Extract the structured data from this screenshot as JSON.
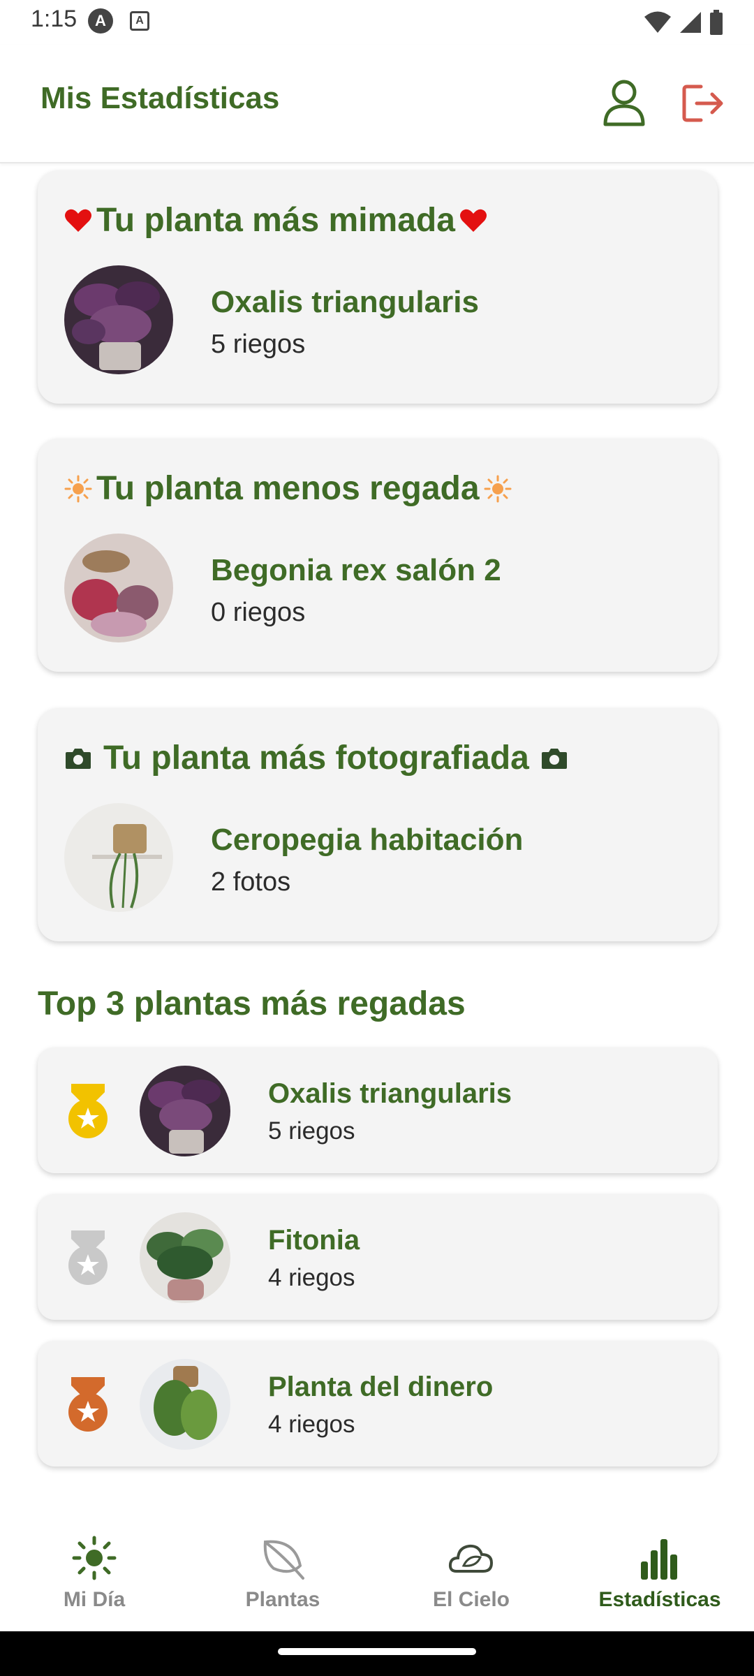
{
  "status": {
    "time": "1:15",
    "icon_a": "A",
    "icon_b": "A"
  },
  "header": {
    "title": "Mis Estadísticas"
  },
  "highlights": [
    {
      "icon": "heart-icon",
      "title": "Tu planta más mimada",
      "name": "Oxalis triangularis",
      "count": "5 riegos"
    },
    {
      "icon": "sun-icon",
      "title": "Tu planta menos regada",
      "name": "Begonia rex salón 2",
      "count": "0 riegos"
    },
    {
      "icon": "camera-icon",
      "title": "Tu planta más fotografiada",
      "name": "Ceropegia habitación",
      "count": "2 fotos"
    }
  ],
  "top3": {
    "title": "Top 3 plantas más regadas",
    "items": [
      {
        "medal": "gold-medal-icon",
        "name": "Oxalis triangularis",
        "count": "5 riegos"
      },
      {
        "medal": "silver-medal-icon",
        "name": "Fitonia",
        "count": "4 riegos"
      },
      {
        "medal": "bronze-medal-icon",
        "name": "Planta del dinero",
        "count": "4 riegos"
      }
    ]
  },
  "nav": [
    {
      "label": "Mi Día",
      "icon": "sun-icon"
    },
    {
      "label": "Plantas",
      "icon": "leaf-icon"
    },
    {
      "label": "El Cielo",
      "icon": "cloud-leaf-icon"
    },
    {
      "label": "Estadísticas",
      "icon": "bar-chart-icon",
      "active": true
    }
  ],
  "colors": {
    "primary": "#3f6b26",
    "heart": "#e31010",
    "sun": "#f6a04d",
    "gold": "#f2c200",
    "silver": "#c9c9c9",
    "bronze": "#d36a2c",
    "logout": "#d55a4e"
  }
}
